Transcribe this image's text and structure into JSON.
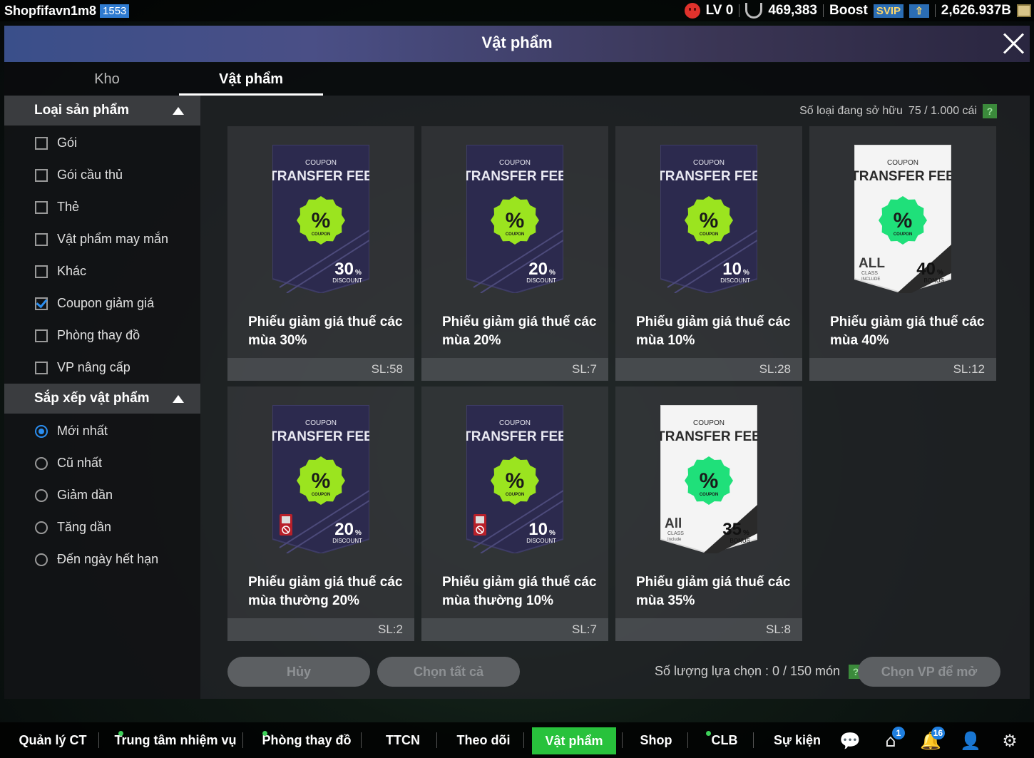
{
  "topbar": {
    "username": "Shopfifavn1m8",
    "uid": "1553",
    "level": "LV 0",
    "fc": "469,383",
    "boost": "Boost",
    "svip": "SVIP",
    "bp": "2,626.937B"
  },
  "title": "Vật phẩm",
  "tabs": [
    {
      "label": "Kho"
    },
    {
      "label": "Vật phẩm"
    }
  ],
  "filter": {
    "header": "Loại sản phẩm",
    "options": [
      {
        "label": "Gói",
        "checked": false
      },
      {
        "label": "Gói cầu thủ",
        "checked": false
      },
      {
        "label": "Thẻ",
        "checked": false
      },
      {
        "label": "Vật phẩm may mắn",
        "checked": false
      },
      {
        "label": "Khác",
        "checked": false
      },
      {
        "label": "Coupon giảm giá",
        "checked": true
      },
      {
        "label": "Phòng thay đồ",
        "checked": false
      },
      {
        "label": "VP nâng cấp",
        "checked": false
      }
    ]
  },
  "sort": {
    "header": "Sắp xếp vật phẩm",
    "options": [
      {
        "label": "Mới nhất",
        "selected": true
      },
      {
        "label": "Cũ nhất",
        "selected": false
      },
      {
        "label": "Giảm dần",
        "selected": false
      },
      {
        "label": "Tăng dần",
        "selected": false
      },
      {
        "label": "Đến ngày hết hạn",
        "selected": false
      }
    ]
  },
  "owned": {
    "label": "Số loại đang sở hữu",
    "value": "75 / 1.000 cái",
    "help": "?"
  },
  "coupon_text": {
    "coupon": "COUPON",
    "transfer_fee": "TRANSFER FEE",
    "percent": "%",
    "discount": "DISCOUNT",
    "bonus": "BONUS",
    "class": "CLASS",
    "all": "ALL",
    "all_small": "All",
    "include_upper": "INCLUDE",
    "include_lower": "Include"
  },
  "items": [
    {
      "name": "Phiếu giảm giá thuế các mùa 30%",
      "pct": "30",
      "qty": "SL:58",
      "style": "dark",
      "kind": "DISCOUNT",
      "restricted": false
    },
    {
      "name": "Phiếu giảm giá thuế các mùa 20%",
      "pct": "20",
      "qty": "SL:7",
      "style": "dark",
      "kind": "DISCOUNT",
      "restricted": false
    },
    {
      "name": "Phiếu giảm giá thuế các mùa 10%",
      "pct": "10",
      "qty": "SL:28",
      "style": "dark",
      "kind": "DISCOUNT",
      "restricted": false
    },
    {
      "name": "Phiếu giảm giá thuế các mùa 40%",
      "pct": "40",
      "qty": "SL:12",
      "style": "white",
      "kind": "BONUS",
      "restricted": false,
      "all_upper": true
    },
    {
      "name": "Phiếu giảm giá thuế các mùa thường 20%",
      "pct": "20",
      "qty": "SL:2",
      "style": "dark",
      "kind": "DISCOUNT",
      "restricted": true
    },
    {
      "name": "Phiếu giảm giá thuế các mùa thường 10%",
      "pct": "10",
      "qty": "SL:7",
      "style": "dark",
      "kind": "DISCOUNT",
      "restricted": true
    },
    {
      "name": "Phiếu giảm giá thuế các mùa 35%",
      "pct": "35",
      "qty": "SL:8",
      "style": "white",
      "kind": "BONUS",
      "restricted": false,
      "all_upper": false
    }
  ],
  "actions": {
    "cancel": "Hủy",
    "select_all": "Chọn tất cả",
    "selection_label": "Số lượng lựa chọn : 0 / 150 món",
    "help": "?",
    "open": "Chọn VP để mở"
  },
  "nav": [
    {
      "label": "Quản lý CT",
      "dot": false,
      "active": false
    },
    {
      "label": "Trung tâm nhiệm vụ",
      "dot": true,
      "active": false
    },
    {
      "label": "Phòng thay đồ",
      "dot": true,
      "active": false
    },
    {
      "label": "TTCN",
      "dot": false,
      "active": false
    },
    {
      "label": "Theo dõi",
      "dot": false,
      "active": false
    },
    {
      "label": "Vật phẩm",
      "dot": false,
      "active": true
    },
    {
      "label": "Shop",
      "dot": false,
      "active": false
    },
    {
      "label": "CLB",
      "dot": true,
      "active": false
    },
    {
      "label": "Sự kiện",
      "dot": false,
      "active": false
    }
  ],
  "nav_badges": {
    "home": "1",
    "bell": "16"
  },
  "colors": {
    "accent_green": "#28c23c",
    "check_blue": "#2b8ef0",
    "coupon_badge": "#9be41f",
    "coupon_badge_white": "#1fe07a"
  }
}
